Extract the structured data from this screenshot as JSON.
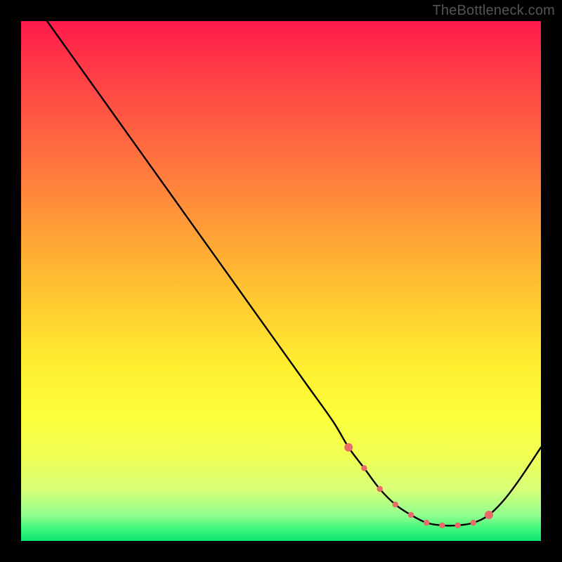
{
  "watermark": "TheBottleneck.com",
  "colors": {
    "background": "#000000",
    "gradient_top": "#ff1a4d",
    "gradient_bottom": "#0de470",
    "curve": "#000000",
    "markers": "#e86a6a"
  },
  "chart_data": {
    "type": "line",
    "title": "",
    "xlabel": "",
    "ylabel": "",
    "xlim": [
      0,
      100
    ],
    "ylim": [
      0,
      100
    ],
    "grid": false,
    "series": [
      {
        "name": "bottleneck-curve",
        "x": [
          5,
          10,
          15,
          20,
          25,
          30,
          35,
          40,
          45,
          50,
          55,
          60,
          63,
          66,
          69,
          72,
          75,
          78,
          81,
          84,
          87,
          90,
          93,
          96,
          100
        ],
        "y": [
          100,
          93,
          86,
          79,
          72,
          65,
          58,
          51,
          44,
          37,
          30,
          23,
          18,
          14,
          10,
          7,
          5,
          3.5,
          3,
          3,
          3.5,
          5,
          8,
          12,
          18
        ]
      }
    ],
    "markers": {
      "name": "highlighted-points",
      "x": [
        63,
        66,
        69,
        72,
        75,
        78,
        81,
        84,
        87,
        90
      ],
      "y": [
        18,
        14,
        10,
        7,
        5,
        3.5,
        3,
        3,
        3.5,
        5
      ]
    }
  }
}
